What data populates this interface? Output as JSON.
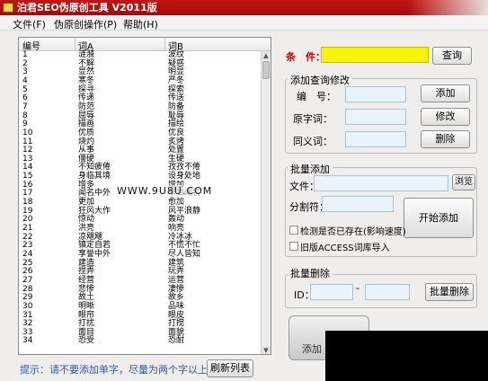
{
  "window": {
    "title": "泊君SEO伪原创工具 V2011版"
  },
  "menu": [
    "文件(F)",
    "伪原创操作(P)",
    "帮助(H)"
  ],
  "list": {
    "headers": [
      "编号",
      "词A",
      "词B"
    ],
    "rows": [
      [
        "1",
        "涟漪",
        "波纹"
      ],
      [
        "2",
        "不解",
        "疑惑"
      ],
      [
        "3",
        "显然",
        "明显"
      ],
      [
        "4",
        "寒冬",
        "严冬"
      ],
      [
        "5",
        "探寻",
        "探索"
      ],
      [
        "6",
        "传递",
        "传送"
      ],
      [
        "7",
        "防范",
        "防备"
      ],
      [
        "8",
        "屈辱",
        "耻辱"
      ],
      [
        "9",
        "描画",
        "描绘"
      ],
      [
        "10",
        "优质",
        "优良"
      ],
      [
        "11",
        "烧灼",
        "炙烤"
      ],
      [
        "12",
        "从事",
        "处置"
      ],
      [
        "13",
        "僵硬",
        "生硬"
      ],
      [
        "14",
        "不知疲倦",
        "孜孜不倦"
      ],
      [
        "15",
        "身临其境",
        "设身处地"
      ],
      [
        "16",
        "增多",
        "增加"
      ],
      [
        "17",
        "闻名中外",
        "举世闻名"
      ],
      [
        "18",
        "更加",
        "愈加"
      ],
      [
        "19",
        "狂风大作",
        "风平浪静"
      ],
      [
        "20",
        "惊动",
        "轰动"
      ],
      [
        "21",
        "洪亮",
        "响亮"
      ],
      [
        "22",
        "凉飕飕",
        "冷冰冰"
      ],
      [
        "23",
        "镇定自若",
        "不慌不忙"
      ],
      [
        "24",
        "享誉中外",
        "尽人皆知"
      ],
      [
        "25",
        "建造",
        "建筑"
      ],
      [
        "26",
        "捏弄",
        "玩弄"
      ],
      [
        "27",
        "经营",
        "运营"
      ],
      [
        "28",
        "悲惨",
        "凄惨"
      ],
      [
        "29",
        "故土",
        "故乡"
      ],
      [
        "30",
        "明晰",
        "品味"
      ],
      [
        "31",
        "眼帘",
        "眼皮"
      ],
      [
        "32",
        "打扰",
        "打搅"
      ],
      [
        "33",
        "面目",
        "面貌"
      ],
      [
        "34",
        "恐受",
        "恐耐"
      ]
    ]
  },
  "watermark": "WWW.9U8U.COM",
  "tip": "提示：请不要添加单字，尽量为两个字以上。",
  "refresh_button": "刷新列表",
  "condition": {
    "label": "条　件：",
    "value": "",
    "query_button": "查询"
  },
  "add_query": {
    "title": "添加查询修改",
    "id_label": "编　号：",
    "orig_label": "原字词：",
    "syn_label": "同义词：",
    "add_button": "添加",
    "modify_button": "修改",
    "delete_button": "删除"
  },
  "batch_add": {
    "title": "批量添加",
    "file_label": "文件：",
    "browse_button": "浏览",
    "separator_label": "分割符：",
    "start_button": "开始添加",
    "check_exists": "检测是否已存在(影响速度)",
    "old_import": "旧版ACCESS词库导入"
  },
  "batch_delete": {
    "title": "批量删除",
    "id_label": "ID：",
    "dash": "-",
    "delete_button": "批量删除"
  },
  "partial_button": "添加"
}
